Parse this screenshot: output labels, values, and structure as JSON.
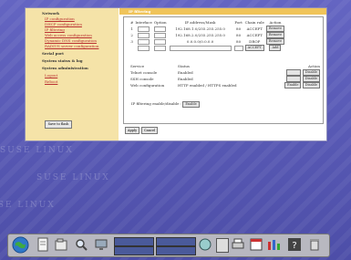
{
  "sidebar": {
    "sections": [
      {
        "title": "Network",
        "links": [
          "IP configuration",
          "DHCP configuration",
          "IP filtering",
          "Web access configuration",
          "Dynamic DNS configuration",
          "RADIUS server configuration"
        ]
      },
      {
        "title": "Serial port",
        "links": []
      },
      {
        "title": "System status & log",
        "links": []
      },
      {
        "title": "System administration",
        "links": [
          "Logout",
          "Reboot"
        ]
      }
    ],
    "button": "Save to flash"
  },
  "main": {
    "title": "IP filtering",
    "filter_headers": [
      "#",
      "Interface",
      "Option",
      "IP address/Mask",
      "Port",
      "Chain rule",
      "Action"
    ],
    "filter_rows": [
      {
        "num": "1",
        "ip": "192.168.1.0/255.255.255.0",
        "port": "80",
        "rule": "ACCEPT",
        "action": "Remove"
      },
      {
        "num": "2",
        "ip": "192.168.2.0/255.255.255.0",
        "port": "80",
        "rule": "ACCEPT",
        "action": "Remove"
      },
      {
        "num": "3",
        "ip": "0.0.0.0/0.0.0.0",
        "port": "80",
        "rule": "DROP",
        "action": "Remove"
      }
    ],
    "new_rule": {
      "rule": "ACCEPT",
      "action": "Add"
    },
    "service_headers": [
      "Service",
      "Status",
      "Action"
    ],
    "services": [
      {
        "name": "Telnet console",
        "status": "Enabled",
        "actions": [
          "Disable"
        ]
      },
      {
        "name": "SSH console",
        "status": "Enabled",
        "actions": [
          "Disable"
        ]
      },
      {
        "name": "Web configuration",
        "status": "HTTP enabled / HTTPS enabled",
        "actions": [
          "Enable",
          "Disable"
        ]
      }
    ],
    "filter_toggle_label": "IP filtering enable/disable :",
    "filter_toggle_value": "Enable",
    "apply": "Apply",
    "cancel": "Cancel"
  },
  "wallpaper_text": "SUSE LINUX"
}
